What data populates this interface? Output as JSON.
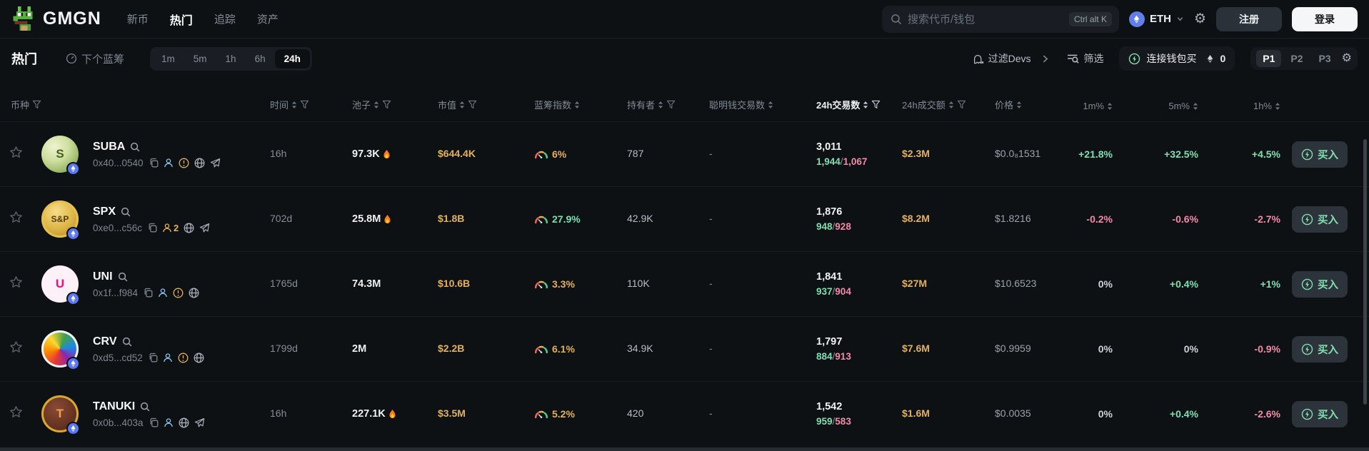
{
  "topbar": {
    "logo": "GMGN",
    "nav": [
      "新币",
      "热门",
      "追踪",
      "资产"
    ],
    "active_nav": "热门",
    "search_placeholder": "搜索代币/钱包",
    "search_shortcut": "Ctrl alt K",
    "chain": "ETH",
    "register": "注册",
    "login": "登录"
  },
  "filterbar": {
    "hot": "热门",
    "next_bluechip": "下个蓝筹",
    "times": [
      "1m",
      "5m",
      "1h",
      "6h",
      "24h"
    ],
    "active_time": "24h",
    "filter_devs": "过滤Devs",
    "filter_label": "筛选",
    "connect_wallet": "连接钱包买",
    "wallet_count": "0",
    "presets": [
      "P1",
      "P2",
      "P3"
    ],
    "active_preset": "P1"
  },
  "labels": {
    "buy": "买入",
    "sep": "/"
  },
  "colors": {
    "bg": "#0e1114",
    "yellow": "#e2b15c",
    "green": "#7ee0b2",
    "red": "#f38ba8",
    "blue_badge": "#5b79f7",
    "buy_green": "#82dfb0",
    "eth_blue": "#627eea"
  },
  "table": {
    "headers": [
      {
        "key": "coin",
        "label": "币种",
        "sort": false,
        "filter": true,
        "active": false
      },
      {
        "key": "age",
        "label": "时间",
        "sort": true,
        "filter": true,
        "active": false
      },
      {
        "key": "pool",
        "label": "池子",
        "sort": true,
        "filter": true,
        "active": false
      },
      {
        "key": "mcap",
        "label": "市值",
        "sort": true,
        "filter": true,
        "active": false
      },
      {
        "key": "bluechip",
        "label": "蓝筹指数",
        "sort": true,
        "filter": false,
        "active": false
      },
      {
        "key": "holders",
        "label": "持有者",
        "sort": true,
        "filter": true,
        "active": false
      },
      {
        "key": "smart",
        "label": "聪明钱交易数",
        "sort": true,
        "filter": false,
        "active": false
      },
      {
        "key": "tx24",
        "label": "24h交易数",
        "sort": true,
        "filter": true,
        "active": true
      },
      {
        "key": "vol24",
        "label": "24h成交额",
        "sort": true,
        "filter": true,
        "active": false
      },
      {
        "key": "price",
        "label": "价格",
        "sort": true,
        "filter": false,
        "active": false
      },
      {
        "key": "m1",
        "label": "1m%",
        "sort": true,
        "filter": false,
        "active": false
      },
      {
        "key": "m5",
        "label": "5m%",
        "sort": true,
        "filter": false,
        "active": false
      },
      {
        "key": "h1",
        "label": "1h%",
        "sort": true,
        "filter": false,
        "active": false
      }
    ],
    "rows": [
      {
        "symbol": "SUBA",
        "address": "0x40...0540",
        "avatar": {
          "label": "S",
          "bg": "radial-gradient(circle at 35% 30%, #eef2d0 0%, #cfe0a0 40%, #9ab868 72%, #74944a 100%)",
          "fg": "#46601f"
        },
        "icons": [
          "copy",
          "person",
          "warning",
          "globe",
          "telegram"
        ],
        "age": "16h",
        "pool": "97.3K",
        "pool_fire": true,
        "mcap": "$644.4K",
        "bluechip_pct": "6%",
        "bluechip_color": "#e2b15c",
        "holders": "787",
        "smart": "-",
        "tx_total": "3,011",
        "tx_buys": "1,944",
        "tx_sells": "1,067",
        "volume": "$2.3M",
        "price": "$0.0₈1531",
        "pct_1m": "+21.8%",
        "pct_5m": "+32.5%",
        "pct_1h": "+4.5%"
      },
      {
        "symbol": "SPX",
        "address": "0xe0...c56c",
        "avatar": {
          "label": "S&P",
          "bg": "radial-gradient(circle at 40% 30%, #f7dd8a 0%, #e0b84a 48%, #a97f1d 100%)",
          "fg": "#503c06",
          "ring": "#e6c14f"
        },
        "icons": [
          "copy",
          "person",
          "globe",
          "telegram"
        ],
        "person_badge": "2",
        "person_color": "#e2b15c",
        "age": "702d",
        "pool": "25.8M",
        "pool_fire": true,
        "mcap": "$1.8B",
        "bluechip_pct": "27.9%",
        "bluechip_color": "#7ee0b2",
        "holders": "42.9K",
        "smart": "-",
        "tx_total": "1,876",
        "tx_buys": "948",
        "tx_sells": "928",
        "volume": "$8.2M",
        "price": "$1.8216",
        "pct_1m": "-0.2%",
        "pct_5m": "-0.6%",
        "pct_1h": "-2.7%"
      },
      {
        "symbol": "UNI",
        "address": "0x1f...f984",
        "avatar": {
          "label": "U",
          "bg": "#fdf0f7",
          "fg": "#ff0a78"
        },
        "icons": [
          "copy",
          "person",
          "warning",
          "globe"
        ],
        "age": "1765d",
        "pool": "74.3M",
        "pool_fire": false,
        "mcap": "$10.6B",
        "bluechip_pct": "3.3%",
        "bluechip_color": "#e2b15c",
        "holders": "110K",
        "smart": "-",
        "tx_total": "1,841",
        "tx_buys": "937",
        "tx_sells": "904",
        "volume": "$27M",
        "price": "$10.6523",
        "pct_1m": "0%",
        "pct_5m": "+0.4%",
        "pct_1h": "+1%"
      },
      {
        "symbol": "CRV",
        "address": "0xd5...cd52",
        "avatar": {
          "label": "",
          "bg": "conic-gradient(from 200deg, #e53935, #fb8c00, #fdd835, #43a047, #1e88e5, #8e24aa, #e53935)",
          "fg": "#ffffff",
          "ring": "#f2f4f6"
        },
        "icons": [
          "copy",
          "person",
          "warning",
          "globe"
        ],
        "age": "1799d",
        "pool": "2M",
        "pool_fire": false,
        "mcap": "$2.2B",
        "bluechip_pct": "6.1%",
        "bluechip_color": "#e2b15c",
        "holders": "34.9K",
        "smart": "-",
        "tx_total": "1,797",
        "tx_buys": "884",
        "tx_sells": "913",
        "volume": "$7.6M",
        "price": "$0.9959",
        "pct_1m": "0%",
        "pct_5m": "0%",
        "pct_1h": "-0.9%"
      },
      {
        "symbol": "TANUKI",
        "address": "0x0b...403a",
        "avatar": {
          "label": "T",
          "bg": "radial-gradient(circle at 40% 35%, #8a4a33 0%, #5c2d1e 70%, #3a1a10 100%)",
          "fg": "#f0a050",
          "ring": "#d9a92f"
        },
        "icons": [
          "copy",
          "person",
          "globe",
          "telegram"
        ],
        "age": "16h",
        "pool": "227.1K",
        "pool_fire": true,
        "mcap": "$3.5M",
        "bluechip_pct": "5.2%",
        "bluechip_color": "#e2b15c",
        "holders": "420",
        "smart": "-",
        "tx_total": "1,542",
        "tx_buys": "959",
        "tx_sells": "583",
        "volume": "$1.6M",
        "price": "$0.0035",
        "pct_1m": "0%",
        "pct_5m": "+0.4%",
        "pct_1h": "-2.6%"
      }
    ]
  }
}
